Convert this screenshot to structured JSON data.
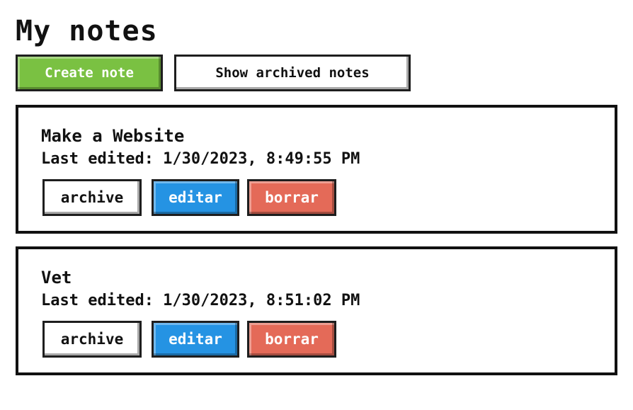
{
  "header": {
    "title": "My notes"
  },
  "toolbar": {
    "create_label": "Create note",
    "archived_label": "Show archived notes"
  },
  "notes": [
    {
      "title": "Make a Website",
      "last_edited": "Last edited: 1/30/2023, 8:49:55 PM",
      "archive_label": "archive",
      "edit_label": "editar",
      "delete_label": "borrar"
    },
    {
      "title": "Vet",
      "last_edited": "Last edited: 1/30/2023, 8:51:02 PM",
      "archive_label": "archive",
      "edit_label": "editar",
      "delete_label": "borrar"
    }
  ],
  "colors": {
    "create": "#7ac142",
    "edit": "#2593e3",
    "delete": "#e46a58",
    "border": "#111111"
  }
}
